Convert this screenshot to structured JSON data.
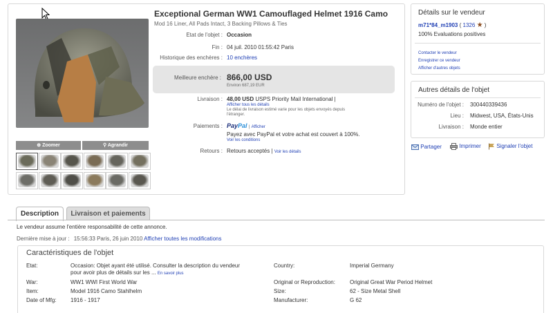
{
  "item": {
    "title": "Exceptional German WW1 Camouflaged Helmet 1916 Camo",
    "subtitle": "Mod 16 Liner, All Pads Intact, 3 Backing Pillows & Ties",
    "condition_label": "Etat de l'objet :",
    "condition_value": "Occasion",
    "end_label": "Fin :",
    "end_value": "04 juil. 2010 01:55:42 Paris",
    "history_label": "Historique des enchères :",
    "history_value": "10 enchères",
    "best_bid_label": "Meilleure enchère :",
    "best_bid_value": "866,00 USD",
    "best_bid_approx": "Environ 687,19 EUR",
    "delivery_label": "Livraison :",
    "delivery_price": "48,00 USD",
    "delivery_service": "USPS Priority Mail International",
    "delivery_sep": "|",
    "delivery_details_link": "Afficher tous les détails",
    "delivery_note_1": "Le délai de livraison estimé varie pour les objets envoyés depuis",
    "delivery_note_2": "l'étranger.",
    "payment_label": "Paiements :",
    "payment_logo_1": "Pay",
    "payment_logo_2": "Pal",
    "payment_sep": "|",
    "payment_show": "Afficher",
    "payment_text": "Payez avec PayPal et votre achat est couvert à 100%.",
    "payment_conditions": "Voir les conditions",
    "returns_label": "Retours :",
    "returns_value": "Retours acceptés",
    "returns_sep": "|",
    "returns_link": "Voir les détails"
  },
  "gallery": {
    "zoom_label": "Zoomer",
    "enlarge_label": "Agrandir",
    "thumbnail_count": 12
  },
  "seller": {
    "heading": "Détails sur le vendeur",
    "name": "m71*84_m1903",
    "score_open": "(",
    "score": "1326",
    "score_close": ")",
    "positive": "100% Evaluations positives",
    "links": [
      "Contacter le vendeur",
      "Enregistrer ce vendeur",
      "Afficher d'autres objets"
    ]
  },
  "other": {
    "heading": "Autres détails de l'objet",
    "number_label": "Numéro de l'objet :",
    "number_value": "300440339436",
    "place_label": "Lieu :",
    "place_value": "Midwest, USA, États-Unis",
    "delivery_label": "Livraison :",
    "delivery_value": "Monde entier"
  },
  "actions": {
    "share": "Partager",
    "print": "Imprimer",
    "report": "Signaler l'objet"
  },
  "tabs": {
    "description": "Description",
    "shipping": "Livraison et paiements"
  },
  "description": {
    "disclaimer": "Le vendeur assume l'entière responsabilité de cette annonce.",
    "update_label": "Dernière mise à jour :",
    "update_value": "15:56:33 Paris, 26 juin 2010",
    "update_link": "Afficher toutes les modifications"
  },
  "features": {
    "title": "Caractéristiques de l'objet",
    "state_label": "Etat:",
    "state_value_1": "Occasion: Objet ayant été utilisé. Consulter la description du vendeur",
    "state_value_2": "pour avoir plus de détails sur les ...",
    "state_more": "En savoir plus",
    "war_label": "War:",
    "war_value": "WW1 WWI First World War",
    "item_label": "Item:",
    "item_value": "Model 1916 Camo Stahlhelm",
    "date_label": "Date of Mfg:",
    "date_value": "1916 - 1917",
    "country_label": "Country:",
    "country_value": "Imperial Germany",
    "orig_label": "Original or Reproduction:",
    "orig_value": "Original Great War Period Helmet",
    "size_label": "Size:",
    "size_value": "62 - Size Metal Shell",
    "maker_label": "Manufacturer:",
    "maker_value": "G 62"
  }
}
